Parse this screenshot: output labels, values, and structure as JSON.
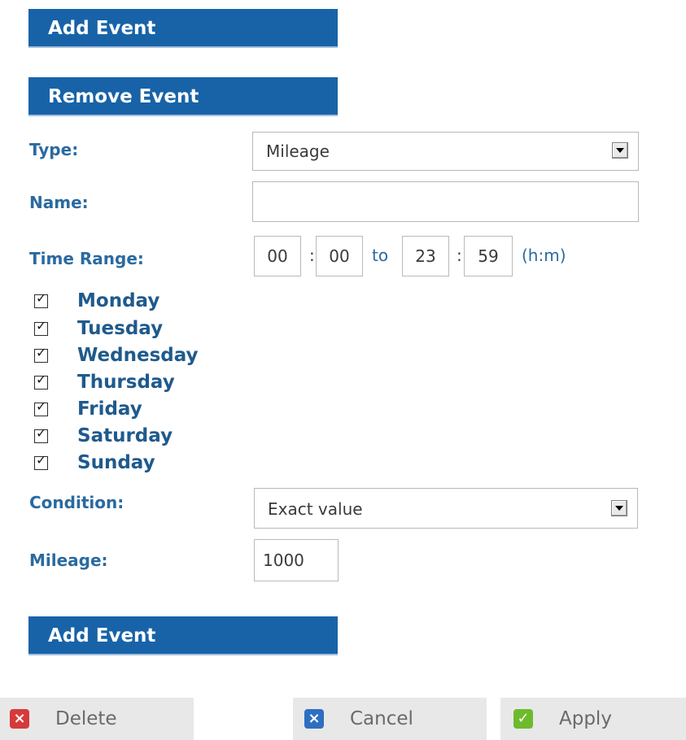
{
  "top_buttons": {
    "add_event": "Add Event",
    "remove_event": "Remove Event"
  },
  "form": {
    "type": {
      "label": "Type:",
      "value": "Mileage"
    },
    "name": {
      "label": "Name:",
      "value": ""
    },
    "time_range": {
      "label": "Time Range:",
      "start_hour": "00",
      "start_minute": "00",
      "separator": ":",
      "to_text": "to",
      "end_hour": "23",
      "end_minute": "59",
      "unit": "(h:m)"
    },
    "days": [
      {
        "label": "Monday",
        "checked": true
      },
      {
        "label": "Tuesday",
        "checked": true
      },
      {
        "label": "Wednesday",
        "checked": true
      },
      {
        "label": "Thursday",
        "checked": true
      },
      {
        "label": "Friday",
        "checked": true
      },
      {
        "label": "Saturday",
        "checked": true
      },
      {
        "label": "Sunday",
        "checked": true
      }
    ],
    "condition": {
      "label": "Condition:",
      "value": "Exact value"
    },
    "mileage": {
      "label": "Mileage:",
      "value": "1000"
    }
  },
  "bottom_button": {
    "add_event": "Add Event"
  },
  "actions": {
    "delete": {
      "label": "Delete",
      "icon": "delete-x-icon",
      "color": "#d63a3a"
    },
    "cancel": {
      "label": "Cancel",
      "icon": "cancel-x-icon",
      "color": "#2d6fc1"
    },
    "apply": {
      "label": "Apply",
      "icon": "checkmark-icon",
      "color": "#6dbb2d"
    }
  }
}
